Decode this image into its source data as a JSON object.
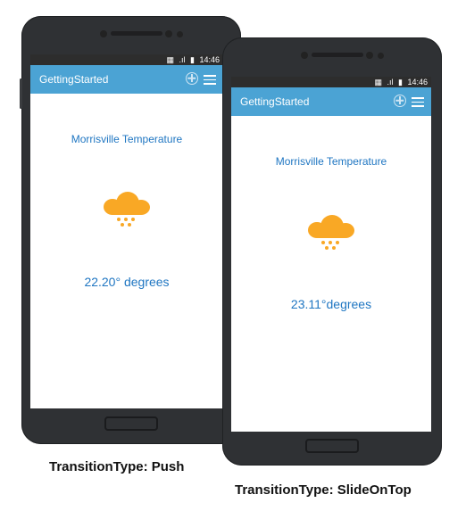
{
  "phones": [
    {
      "status_time": "14:46",
      "app_title": "GettingStarted",
      "city_label": "Morrisville Temperature",
      "weather_icon": "cloud-snow-icon",
      "temperature": "22.20° degrees",
      "caption": "TransitionType: Push"
    },
    {
      "status_time": "14:46",
      "app_title": "GettingStarted",
      "city_label": "Morrisville Temperature",
      "weather_icon": "cloud-snow-icon",
      "temperature": "23.11°degrees",
      "caption": "TransitionType: SlideOnTop"
    }
  ],
  "colors": {
    "appbar": "#4ba3d4",
    "accent_text": "#1f76c2",
    "weather_icon": "#f9a825",
    "device_body": "#2f3134"
  }
}
